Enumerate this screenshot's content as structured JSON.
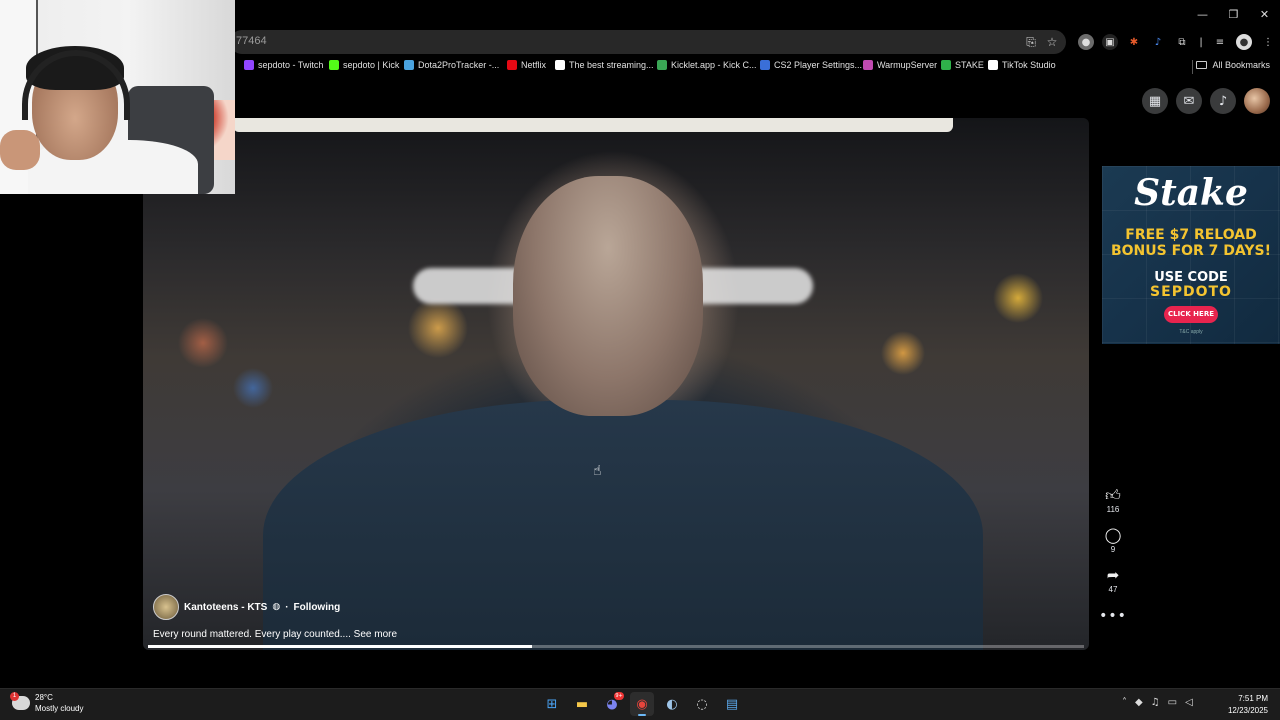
{
  "browser": {
    "url_fragment": "77464",
    "window_controls": {
      "minimize": "—",
      "restore": "❐",
      "close": "✕"
    },
    "bookmarks": [
      {
        "label": "sepdoto - Twitch",
        "color": "#9146ff",
        "icon": "twitch-icon"
      },
      {
        "label": "sepdoto | Kick",
        "color": "#53fc18",
        "icon": "kick-icon"
      },
      {
        "label": "Dota2ProTracker -...",
        "color": "#4aa3df",
        "icon": "dota2protracker-icon"
      },
      {
        "label": "Netflix",
        "color": "#e50914",
        "icon": "netflix-icon"
      },
      {
        "label": "The best streaming...",
        "color": "#ffffff",
        "icon": "diamond-icon"
      },
      {
        "label": "Kicklet.app - Kick C...",
        "color": "#3aa655",
        "icon": "kicklet-icon"
      },
      {
        "label": "CS2 Player Settings...",
        "color": "#3a6fd8",
        "icon": "gear-icon"
      },
      {
        "label": "WarmupServer",
        "color": "#c04ab0",
        "icon": "warmupserver-icon"
      },
      {
        "label": "STAKE",
        "color": "#2fb24a",
        "icon": "stake-icon"
      },
      {
        "label": "TikTok Studio",
        "color": "#ffffff",
        "icon": "tiktok-icon"
      }
    ],
    "all_bookmarks": "All Bookmarks"
  },
  "facebook": {
    "post": {
      "author": "Kantoteens - KTS",
      "visibility_icon": "globe-icon",
      "follow_status": "Following",
      "caption": "Every round mattered. Every play counted....",
      "see_more": "See more",
      "progress": 0.41
    },
    "reactions": {
      "likes": "116",
      "comments": "9",
      "shares": "47"
    }
  },
  "ad": {
    "brand": "Stake",
    "line1": "FREE $7 RELOAD",
    "line2": "BONUS FOR 7 DAYS!",
    "code_label": "USE CODE",
    "code": "SEPDOTO",
    "cta": "CLICK HERE",
    "fine_print": "T&C apply"
  },
  "taskbar": {
    "weather_temp": "28°C",
    "weather_desc": "Mostly cloudy",
    "weather_badge": "1",
    "discord_badge": "9+",
    "time": "7:51 PM",
    "date": "12/23/2025"
  }
}
